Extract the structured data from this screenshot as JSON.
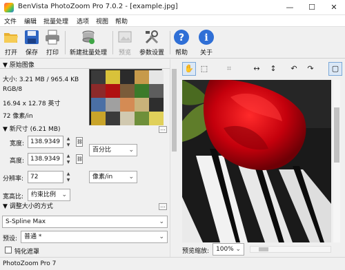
{
  "window": {
    "title": "BenVista PhotoZoom Pro 7.0.2 - [example.jpg]",
    "minimize": "—",
    "maximize": "☐",
    "close": "✕"
  },
  "menu": [
    "文件",
    "编辑",
    "批量处理",
    "选项",
    "视图",
    "帮助"
  ],
  "toolbar": {
    "buttons": [
      {
        "label": "打开",
        "icon": "folder-open-icon"
      },
      {
        "label": "保存",
        "icon": "floppy-disk-icon"
      },
      {
        "label": "打印",
        "icon": "printer-icon"
      },
      {
        "label": "新建批量处理",
        "icon": "batch-stack-icon"
      },
      {
        "label": "预览",
        "icon": "preview-image-icon",
        "disabled": true
      },
      {
        "label": "参数设置",
        "icon": "tools-icon"
      },
      {
        "label": "帮助",
        "icon": "help-circle-icon"
      },
      {
        "label": "关于",
        "icon": "info-circle-icon"
      }
    ]
  },
  "original_image": {
    "header": "▼ 原始图像",
    "size": "大小: 3.21 MB / 965.4 KB",
    "mode": "RGB/8",
    "dimensions": "16.94 x 12.78 英寸",
    "resolution": "72 像素/in"
  },
  "new_size": {
    "header": "▼ 新尺寸 (6.21 MB)",
    "width_label": "宽度:",
    "width_value": "138.9349",
    "height_label": "高度:",
    "height_value": "138.9349",
    "unit_select": "百分比",
    "resolution_label": "分辨率:",
    "resolution_value": "72",
    "resolution_unit_select": "像素/in",
    "aspect_label": "宽高比:",
    "aspect_select": "约束比例"
  },
  "resize_method": {
    "header": "▼ 调整大小的方式",
    "method_select": "S-Spline Max",
    "preset_label": "预设:",
    "preset_select": "普通 *"
  },
  "sharpen": {
    "label": "钝化遮罩"
  },
  "preview": {
    "zoom_label": "预览缩放:",
    "zoom_value": "100%"
  },
  "status": {
    "text": "PhotoZoom Pro 7"
  },
  "colors": {
    "accent": "#2f6fd6",
    "rose": "#c4000c",
    "background": "#f0f0f0"
  }
}
